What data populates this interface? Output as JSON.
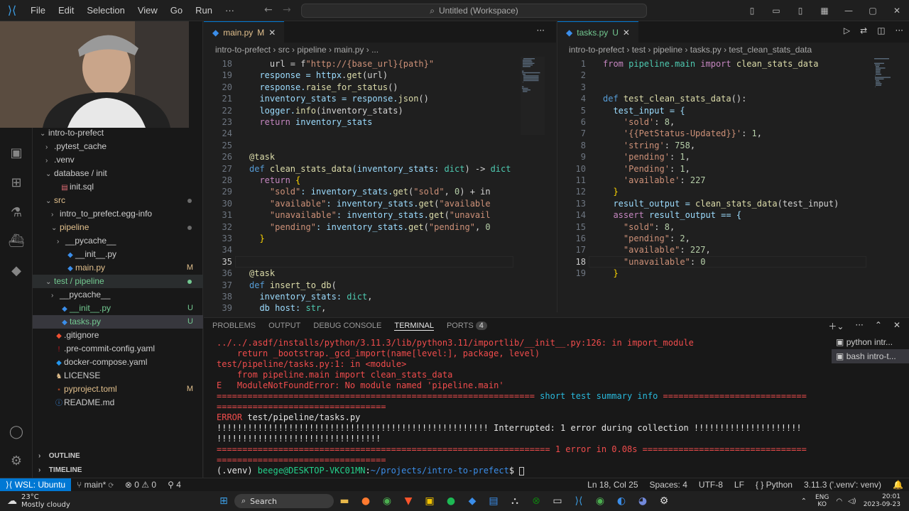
{
  "app": {
    "title": "Untitled (Workspace)",
    "menu": [
      "File",
      "Edit",
      "Selection",
      "View",
      "Go",
      "Run"
    ]
  },
  "explorer": {
    "rows": [
      {
        "label": "intro-to-prefect",
        "indent": 1,
        "twisty": "open",
        "icon": "",
        "badge": ""
      },
      {
        "label": ".pytest_cache",
        "indent": 2,
        "twisty": "closed",
        "icon": "",
        "badge": ""
      },
      {
        "label": ".venv",
        "indent": 2,
        "twisty": "closed",
        "icon": "",
        "badge": ""
      },
      {
        "label": "database / init",
        "indent": 2,
        "twisty": "open",
        "icon": "",
        "badge": ""
      },
      {
        "label": "init.sql",
        "indent": 3,
        "twisty": "",
        "icon": "db",
        "badge": ""
      },
      {
        "label": "src",
        "indent": 2,
        "twisty": "open",
        "icon": "",
        "badge": "dot"
      },
      {
        "label": "intro_to_prefect.egg-info",
        "indent": 3,
        "twisty": "closed",
        "icon": "",
        "badge": ""
      },
      {
        "label": "pipeline",
        "indent": 3,
        "twisty": "open",
        "icon": "",
        "badge": "dot"
      },
      {
        "label": "__pycache__",
        "indent": 4,
        "twisty": "closed",
        "icon": "",
        "badge": ""
      },
      {
        "label": "__init__.py",
        "indent": 4,
        "twisty": "",
        "icon": "py",
        "badge": ""
      },
      {
        "label": "main.py",
        "indent": 4,
        "twisty": "",
        "icon": "py",
        "badge": "M"
      },
      {
        "label": "test / pipeline",
        "indent": 2,
        "twisty": "open",
        "icon": "",
        "badge": "dot"
      },
      {
        "label": "__pycache__",
        "indent": 3,
        "twisty": "closed",
        "icon": "",
        "badge": ""
      },
      {
        "label": "__init__.py",
        "indent": 3,
        "twisty": "",
        "icon": "py",
        "badge": "U"
      },
      {
        "label": "tasks.py",
        "indent": 3,
        "twisty": "",
        "icon": "py",
        "badge": "U"
      },
      {
        "label": ".gitignore",
        "indent": 2,
        "twisty": "",
        "icon": "git",
        "badge": ""
      },
      {
        "label": ".pre-commit-config.yaml",
        "indent": 2,
        "twisty": "",
        "icon": "yaml",
        "badge": ""
      },
      {
        "label": "docker-compose.yaml",
        "indent": 2,
        "twisty": "",
        "icon": "docker",
        "badge": ""
      },
      {
        "label": "LICENSE",
        "indent": 2,
        "twisty": "",
        "icon": "lic",
        "badge": ""
      },
      {
        "label": "pyproject.toml",
        "indent": 2,
        "twisty": "",
        "icon": "toml",
        "badge": "M"
      },
      {
        "label": "README.md",
        "indent": 2,
        "twisty": "",
        "icon": "md",
        "badge": ""
      }
    ],
    "outline": "OUTLINE",
    "timeline": "TIMELINE"
  },
  "editor1": {
    "tab": {
      "name": "main.py",
      "status": "M"
    },
    "breadcrumb": "intro-to-prefect  ›  src  ›  pipeline  ›  main.py  ›  ...",
    "first_line": 18,
    "current_line": 35,
    "lines": [
      [
        [
          "    url = f",
          "plain"
        ],
        [
          "\"http://{base_url}{path}\"",
          "str"
        ]
      ],
      [
        [
          "  response = ",
          "var"
        ],
        [
          "httpx",
          "var"
        ],
        [
          ".",
          "plain"
        ],
        [
          "get",
          "fn"
        ],
        [
          "(url)",
          "plain"
        ]
      ],
      [
        [
          "  response.",
          "var"
        ],
        [
          "raise_for_status",
          "fn"
        ],
        [
          "()",
          "plain"
        ]
      ],
      [
        [
          "  inventory_stats = response.",
          "var"
        ],
        [
          "json",
          "fn"
        ],
        [
          "()",
          "plain"
        ]
      ],
      [
        [
          "  logger.",
          "var"
        ],
        [
          "info",
          "fn"
        ],
        [
          "(inventory_stats)",
          "plain"
        ]
      ],
      [
        [
          "  ",
          "plain"
        ],
        [
          "return",
          "kw2"
        ],
        [
          " inventory_stats",
          "var"
        ]
      ],
      [
        [
          "",
          "plain"
        ]
      ],
      [
        [
          "",
          "plain"
        ]
      ],
      [
        [
          "@task",
          "dec"
        ]
      ],
      [
        [
          "def ",
          "kw"
        ],
        [
          "clean_stats_data",
          "fn"
        ],
        [
          "(inventory_stats: ",
          "var"
        ],
        [
          "dict",
          "cls"
        ],
        [
          ") -> ",
          "plain"
        ],
        [
          "dict",
          "cls"
        ]
      ],
      [
        [
          "  ",
          "plain"
        ],
        [
          "return",
          "kw2"
        ],
        [
          " {",
          "br"
        ]
      ],
      [
        [
          "    ",
          "plain"
        ],
        [
          "\"sold\"",
          "str"
        ],
        [
          ": inventory_stats.",
          "var"
        ],
        [
          "get",
          "fn"
        ],
        [
          "(",
          "plain"
        ],
        [
          "\"sold\"",
          "str"
        ],
        [
          ", ",
          "plain"
        ],
        [
          "0",
          "num2"
        ],
        [
          ") + in",
          "plain"
        ]
      ],
      [
        [
          "    ",
          "plain"
        ],
        [
          "\"available\"",
          "str"
        ],
        [
          ": inventory_stats.",
          "var"
        ],
        [
          "get",
          "fn"
        ],
        [
          "(",
          "plain"
        ],
        [
          "\"available",
          "str"
        ]
      ],
      [
        [
          "    ",
          "plain"
        ],
        [
          "\"unavailable\"",
          "str"
        ],
        [
          ": inventory_stats.",
          "var"
        ],
        [
          "get",
          "fn"
        ],
        [
          "(",
          "plain"
        ],
        [
          "\"unavail",
          "str"
        ]
      ],
      [
        [
          "    ",
          "plain"
        ],
        [
          "\"pending\"",
          "str"
        ],
        [
          ": inventory_stats.",
          "var"
        ],
        [
          "get",
          "fn"
        ],
        [
          "(",
          "plain"
        ],
        [
          "\"pending\"",
          "str"
        ],
        [
          ", ",
          "plain"
        ],
        [
          "0",
          "num2"
        ]
      ],
      [
        [
          "  }",
          "br"
        ]
      ],
      [
        [
          "",
          "plain"
        ]
      ],
      [
        [
          "",
          "plain"
        ]
      ],
      [
        [
          "@task",
          "dec"
        ]
      ],
      [
        [
          "def ",
          "kw"
        ],
        [
          "insert_to_db",
          "fn"
        ],
        [
          "(",
          "plain"
        ]
      ],
      [
        [
          "  inventory_stats: ",
          "var"
        ],
        [
          "dict",
          "cls"
        ],
        [
          ",",
          "plain"
        ]
      ],
      [
        [
          "  db_host: ",
          "var"
        ],
        [
          "str",
          "cls"
        ],
        [
          ",",
          "plain"
        ]
      ]
    ]
  },
  "editor2": {
    "tab": {
      "name": "tasks.py",
      "status": "U"
    },
    "breadcrumb": "intro-to-prefect  ›  test  ›  pipeline  ›  tasks.py  ›  test_clean_stats_data",
    "first_line": 1,
    "current_line": 18,
    "lines": [
      [
        [
          "from ",
          "kw2"
        ],
        [
          "pipeline.main ",
          "cls"
        ],
        [
          "import ",
          "kw2"
        ],
        [
          "clean_stats_data",
          "fn"
        ]
      ],
      [
        [
          "",
          "plain"
        ]
      ],
      [
        [
          "",
          "plain"
        ]
      ],
      [
        [
          "def ",
          "kw"
        ],
        [
          "test_clean_stats_data",
          "fn"
        ],
        [
          "():",
          "plain"
        ]
      ],
      [
        [
          "  test_input = {",
          "var"
        ]
      ],
      [
        [
          "    ",
          "plain"
        ],
        [
          "'sold'",
          "str"
        ],
        [
          ": ",
          "plain"
        ],
        [
          "8",
          "num2"
        ],
        [
          ",",
          "plain"
        ]
      ],
      [
        [
          "    ",
          "plain"
        ],
        [
          "'{{PetStatus-Updated}}'",
          "str"
        ],
        [
          ": ",
          "plain"
        ],
        [
          "1",
          "num2"
        ],
        [
          ",",
          "plain"
        ]
      ],
      [
        [
          "    ",
          "plain"
        ],
        [
          "'string'",
          "str"
        ],
        [
          ": ",
          "plain"
        ],
        [
          "758",
          "num2"
        ],
        [
          ",",
          "plain"
        ]
      ],
      [
        [
          "    ",
          "plain"
        ],
        [
          "'pending'",
          "str"
        ],
        [
          ": ",
          "plain"
        ],
        [
          "1",
          "num2"
        ],
        [
          ",",
          "plain"
        ]
      ],
      [
        [
          "    ",
          "plain"
        ],
        [
          "'Pending'",
          "str"
        ],
        [
          ": ",
          "plain"
        ],
        [
          "1",
          "num2"
        ],
        [
          ",",
          "plain"
        ]
      ],
      [
        [
          "    ",
          "plain"
        ],
        [
          "'available'",
          "str"
        ],
        [
          ": ",
          "plain"
        ],
        [
          "227",
          "num2"
        ]
      ],
      [
        [
          "  }",
          "br"
        ]
      ],
      [
        [
          "  result_output = ",
          "var"
        ],
        [
          "clean_stats_data",
          "fn"
        ],
        [
          "(test_input)",
          "plain"
        ]
      ],
      [
        [
          "  ",
          "plain"
        ],
        [
          "assert ",
          "kw2"
        ],
        [
          "result_output == {",
          "var"
        ]
      ],
      [
        [
          "    ",
          "plain"
        ],
        [
          "\"sold\"",
          "str"
        ],
        [
          ": ",
          "plain"
        ],
        [
          "8",
          "num2"
        ],
        [
          ",",
          "plain"
        ]
      ],
      [
        [
          "    ",
          "plain"
        ],
        [
          "\"pending\"",
          "str"
        ],
        [
          ": ",
          "plain"
        ],
        [
          "2",
          "num2"
        ],
        [
          ",",
          "plain"
        ]
      ],
      [
        [
          "    ",
          "plain"
        ],
        [
          "\"available\"",
          "str"
        ],
        [
          ": ",
          "plain"
        ],
        [
          "227",
          "num2"
        ],
        [
          ",",
          "plain"
        ]
      ],
      [
        [
          "    ",
          "plain"
        ],
        [
          "\"unavailable\"",
          "str"
        ],
        [
          ": ",
          "plain"
        ],
        [
          "0",
          "num2"
        ]
      ],
      [
        [
          "  }",
          "br"
        ]
      ]
    ]
  },
  "panel": {
    "tabs": [
      "PROBLEMS",
      "OUTPUT",
      "DEBUG CONSOLE",
      "TERMINAL",
      "PORTS"
    ],
    "ports_count": "4",
    "terminals": [
      "python intr...",
      "bash intro-t..."
    ],
    "lines": [
      [
        [
          "../../.asdf/installs/python/3.11.3/lib/python3.11/importlib/__init__.py:126: in import_module",
          "red"
        ]
      ],
      [
        [
          "    return _bootstrap._gcd_import(name[level:], package, level)",
          "red"
        ]
      ],
      [
        [
          "test/pipeline/tasks.py:1: in <module>",
          "red"
        ]
      ],
      [
        [
          "    from pipeline.main import clean_stats_data",
          "red"
        ]
      ],
      [
        [
          "E   ModuleNotFoundError: No module named 'pipeline.main'",
          "red"
        ]
      ],
      [
        [
          "============================================================== ",
          "red"
        ],
        [
          "short test summary info",
          "cya"
        ],
        [
          " ============================",
          "red"
        ]
      ],
      [
        [
          "=================================",
          "red"
        ]
      ],
      [
        [
          "ERROR ",
          "red"
        ],
        [
          "test/pipeline/tasks.py",
          "wht"
        ]
      ],
      [
        [
          "!!!!!!!!!!!!!!!!!!!!!!!!!!!!!!!!!!!!!!!!!!!!!!!!!!!!! Interrupted: 1 error during collection !!!!!!!!!!!!!!!!!!!!!",
          "wht"
        ]
      ],
      [
        [
          "!!!!!!!!!!!!!!!!!!!!!!!!!!!!!!!!",
          "wht"
        ]
      ],
      [
        [
          "================================================================= ",
          "red"
        ],
        [
          "1 error in 0.08s",
          "red"
        ],
        [
          " ================================",
          "red"
        ]
      ],
      [
        [
          "=================================",
          "red"
        ]
      ],
      [
        [
          "(.venv) ",
          "wht"
        ],
        [
          "beege@DESKTOP-VKC01MN",
          "grn"
        ],
        [
          ":",
          "wht"
        ],
        [
          "~/projects/intro-to-prefect",
          "blu"
        ],
        [
          "$ ",
          "wht"
        ]
      ]
    ]
  },
  "statusbar": {
    "remote": "WSL: Ubuntu",
    "branch": "main*",
    "errors": "0",
    "warnings": "0",
    "ports": "4",
    "position": "Ln 18, Col 25",
    "spaces": "Spaces: 4",
    "encoding": "UTF-8",
    "eol": "LF",
    "language": "Python",
    "interpreter": "3.11.3 ('.venv': venv)"
  },
  "taskbar": {
    "temp": "23°C",
    "weather": "Mostly cloudy",
    "search": "Search",
    "lang1": "ENG",
    "lang2": "KO",
    "time": "20:01",
    "date": "2023-09-23"
  },
  "colors": {
    "accent": "#0078d4",
    "error": "#f14c4c",
    "added": "#73c991",
    "modified": "#e2c08d"
  }
}
